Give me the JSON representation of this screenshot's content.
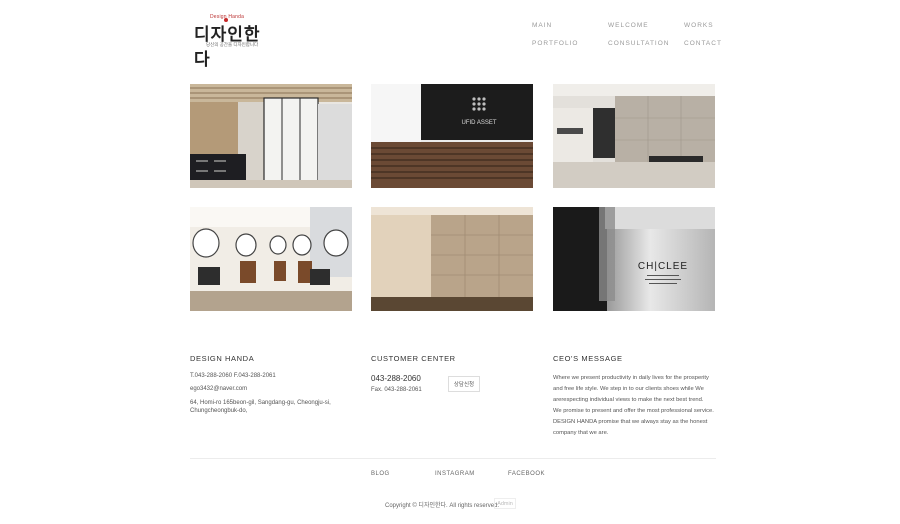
{
  "header": {
    "logo_text": "디자인한다",
    "logo_sub": "Design Handa",
    "logo_tagline": "당신의 공간을 디자인합니다"
  },
  "nav": [
    {
      "label": "MAIN"
    },
    {
      "label": "WELCOME"
    },
    {
      "label": "WORKS"
    },
    {
      "label": "PORTFOLIO"
    },
    {
      "label": "CONSULTATION"
    },
    {
      "label": "CONTACT"
    }
  ],
  "gallery": [
    {
      "name": "office-interior"
    },
    {
      "name": "ufid-asset-reception",
      "sign": "UFID ASSET"
    },
    {
      "name": "kitchen-showroom"
    },
    {
      "name": "hair-salon"
    },
    {
      "name": "stone-wall-lobby"
    },
    {
      "name": "chiclee-reception",
      "sign": "CH|CLEE"
    }
  ],
  "footer": {
    "company": {
      "title": "DESIGN HANDA",
      "tel_fax": "T.043-288-2060  F.043-288-2061",
      "email": "ego3432@naver.com",
      "address_1": "64, Homi-ro 165beon-gil, Sangdang-gu, Cheongju-si,",
      "address_2": "Chungcheongbuk-do,"
    },
    "customer": {
      "title": "CUSTOMER CENTER",
      "phone": "043-288-2060",
      "fax": "Fax.  043-288-2061",
      "consult_label": "상담신청"
    },
    "ceo": {
      "title": "CEO'S MESSAGE",
      "lines": [
        "Where we present productivity in daily lives for the prosperity",
        "and free life style. We step in to our clients shoes while We",
        "arerespecting individual views to make the next best trend.",
        "We promise to present and offer the most professional service.",
        "DESIGN HANDA promise that we always stay as the honest",
        "company that we are."
      ]
    },
    "links": [
      {
        "label": "BLOG"
      },
      {
        "label": "INSTAGRAM"
      },
      {
        "label": "FACEBOOK"
      }
    ],
    "copyright": "Copyright © 디자인한다. All rights reserved.",
    "admin_label": "Admin"
  }
}
